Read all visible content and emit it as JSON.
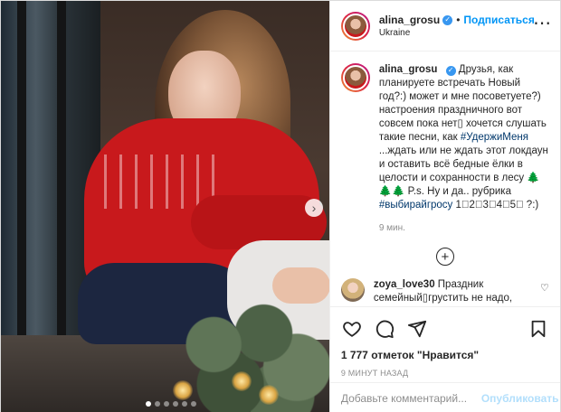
{
  "header": {
    "username": "alina_grosu",
    "separator": "•",
    "follow_label": "Подписаться",
    "location": "Ukraine",
    "more_icon": "more-horizontal-icon"
  },
  "caption": {
    "username": "alina_grosu",
    "text_1": "Друзья, как планируете встречать Новый год?:) может и мне посоветуете?) настроения праздничного вот совсем пока нет▯ хочется слушать такие песни, как ",
    "hashtag_1": "#УдержиМеня",
    "text_2": " ...ждать или не ждать этот локдаун и оставить всё бедные ёлки в целости и сохранности в лесу 🌲🌲🌲 P.s. Ну и да.. рубрика ",
    "hashtag_2": "#выбирайгросу",
    "text_3": " 1⃣2⃣3⃣4⃣5⃣ ?:)",
    "time": "9 мин."
  },
  "load_more_symbol": "+",
  "comment": {
    "username": "zoya_love30",
    "text": " Праздник семейный▯грустить не надо, чудо обязательно будет+˚+˚+˚"
  },
  "actions": {
    "likes": "1 777 отметок \"Нравится\"",
    "date": "9 МИНУТ НАЗАД"
  },
  "add_comment": {
    "placeholder": "Добавьте комментарий...",
    "publish_label": "Опубликовать"
  },
  "media": {
    "next_icon": "chevron-right-icon",
    "next_symbol": "›",
    "slides_count": 6,
    "active_slide": 1
  },
  "colors": {
    "accent": "#0095f6",
    "verified": "#3897f0",
    "hashtag": "#00376b",
    "sweater": "#c8191c"
  }
}
